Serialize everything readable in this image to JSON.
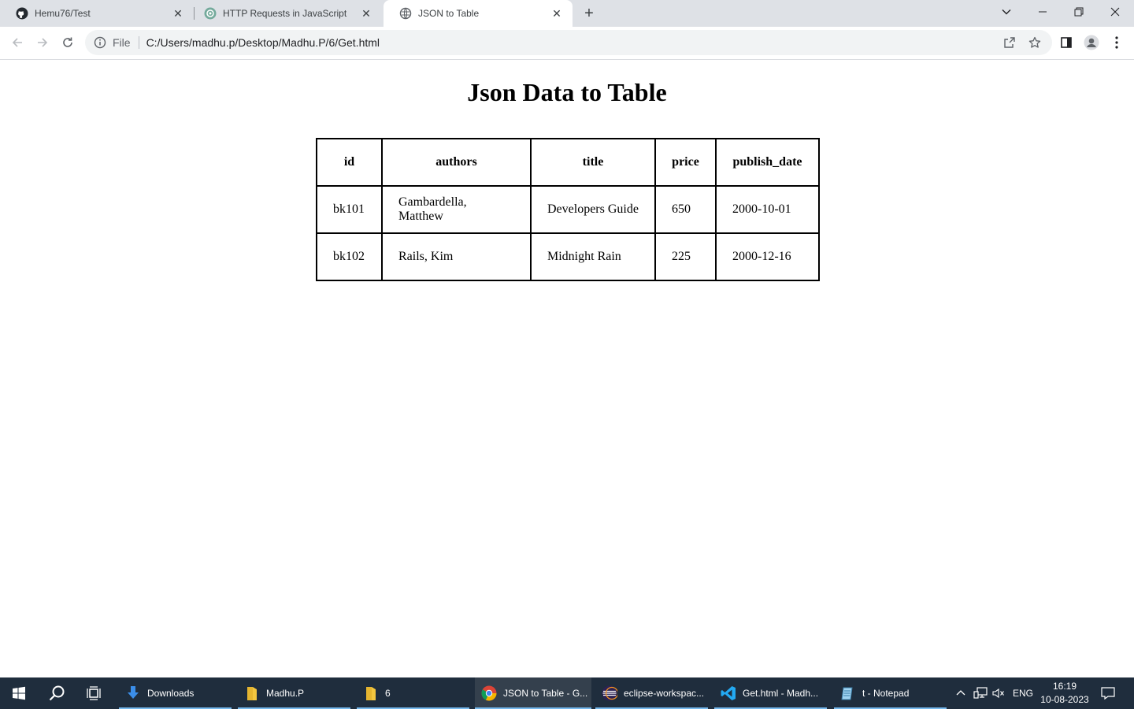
{
  "browser": {
    "tabs": [
      {
        "label": "Hemu76/Test",
        "icon": "github-icon",
        "active": false
      },
      {
        "label": "HTTP Requests in JavaScript",
        "icon": "chatgpt-icon",
        "active": false
      },
      {
        "label": "JSON to Table",
        "icon": "globe-icon",
        "active": true
      }
    ],
    "address": {
      "scheme_label": "File",
      "url": "C:/Users/madhu.p/Desktop/Madhu.P/6/Get.html"
    }
  },
  "page": {
    "heading": "Json Data to Table",
    "table": {
      "headers": [
        "id",
        "authors",
        "title",
        "price",
        "publish_date"
      ],
      "rows": [
        [
          "bk101",
          "Gambardella, Matthew",
          "Developers Guide",
          "650",
          "2000-10-01"
        ],
        [
          "bk102",
          "Rails, Kim",
          "Midnight Rain",
          "225",
          "2000-12-16"
        ]
      ]
    }
  },
  "taskbar": {
    "items": [
      {
        "label": "Downloads",
        "icon": "download-icon",
        "active": false
      },
      {
        "label": "Madhu.P",
        "icon": "folder-icon",
        "active": false
      },
      {
        "label": "6",
        "icon": "folder-icon",
        "active": false
      },
      {
        "label": "JSON to Table - G...",
        "icon": "chrome-icon",
        "active": true
      },
      {
        "label": "eclipse-workspac...",
        "icon": "eclipse-icon",
        "active": false
      },
      {
        "label": "Get.html - Madh...",
        "icon": "vscode-icon",
        "active": false
      },
      {
        "label": "t - Notepad",
        "icon": "notepad-icon",
        "active": false
      }
    ],
    "language": "ENG",
    "time": "16:19",
    "date": "10-08-2023"
  }
}
